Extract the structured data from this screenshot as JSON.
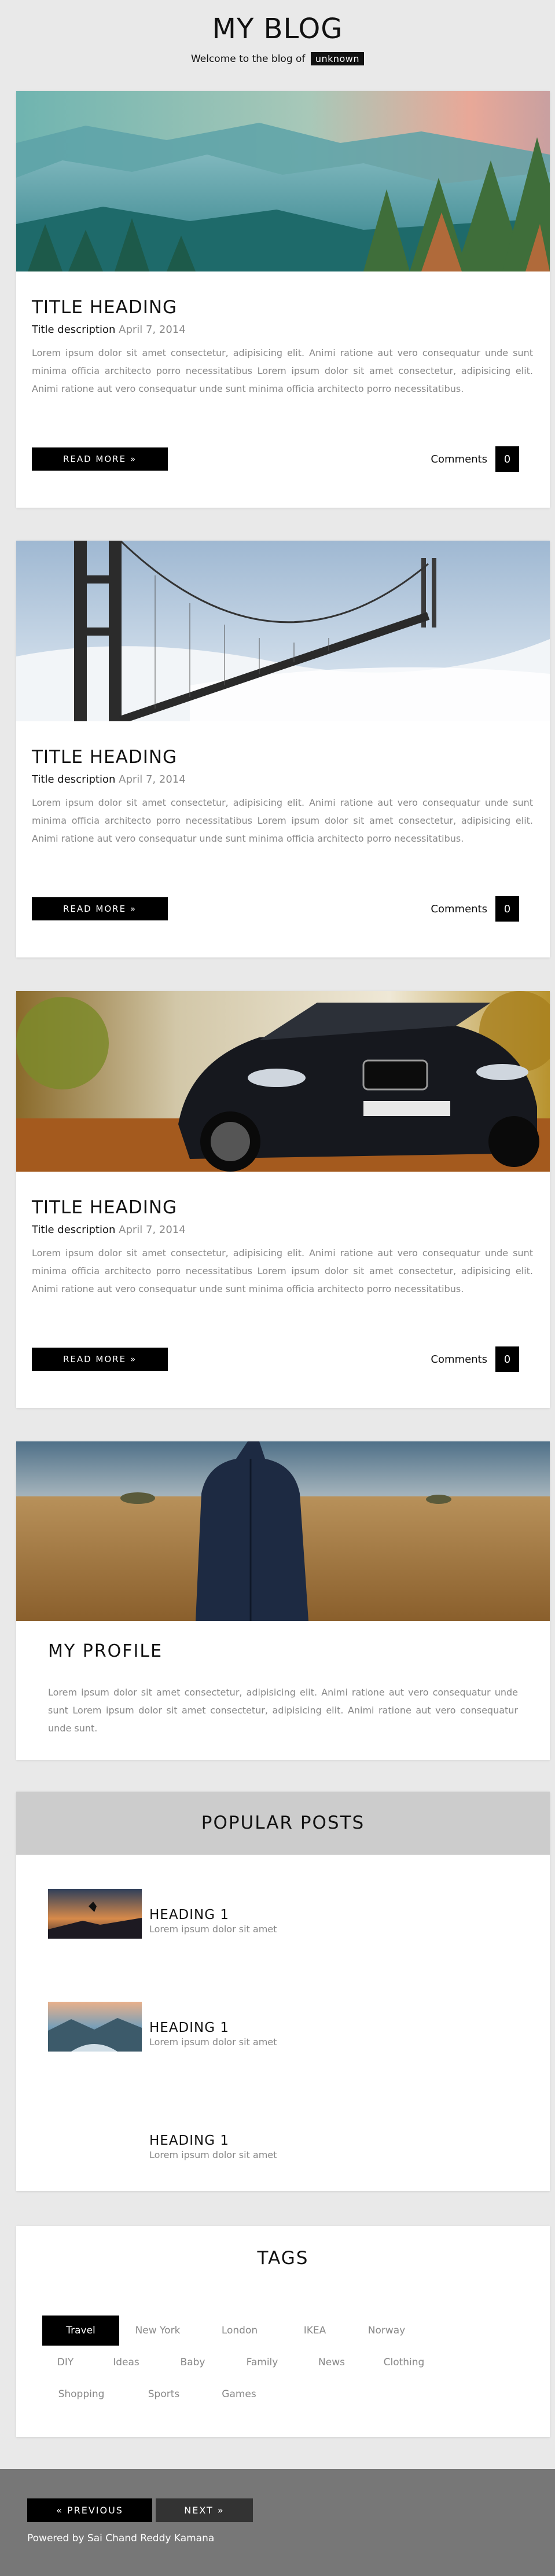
{
  "header": {
    "title": "MY BLOG",
    "subtitle": "Welcome to the blog of",
    "username": "unknown"
  },
  "posts": [
    {
      "image_icon": "forest-landscape-image",
      "heading": "TITLE HEADING",
      "description": "Title description",
      "date": "April 7, 2014",
      "body": "Lorem ipsum dolor sit amet consectetur, adipisicing elit. Animi ratione aut vero consequatur unde sunt minima officia architecto porro necessitatibus Lorem ipsum dolor sit amet consectetur, adipisicing elit. Animi ratione aut vero consequatur unde sunt minima officia architecto porro necessitatibus.",
      "read_more": "READ MORE »",
      "comments_label": "Comments",
      "comments_count": "0"
    },
    {
      "image_icon": "golden-gate-bridge-image",
      "heading": "TITLE HEADING",
      "description": "Title description",
      "date": "April 7, 2014",
      "body": "Lorem ipsum dolor sit amet consectetur, adipisicing elit. Animi ratione aut vero consequatur unde sunt minima officia architecto porro necessitatibus Lorem ipsum dolor sit amet consectetur, adipisicing elit. Animi ratione aut vero consequatur unde sunt minima officia architecto porro necessitatibus.",
      "read_more": "READ MORE »",
      "comments_label": "Comments",
      "comments_count": "0"
    },
    {
      "image_icon": "black-car-image",
      "heading": "TITLE HEADING",
      "description": "Title description",
      "date": "April 7, 2014",
      "body": "Lorem ipsum dolor sit amet consectetur, adipisicing elit. Animi ratione aut vero consequatur unde sunt minima officia architecto porro necessitatibus Lorem ipsum dolor sit amet consectetur, adipisicing elit. Animi ratione aut vero consequatur unde sunt minima officia architecto porro necessitatibus.",
      "read_more": "READ MORE »",
      "comments_label": "Comments",
      "comments_count": "0"
    }
  ],
  "profile": {
    "image_icon": "person-in-field-image",
    "heading": "MY PROFILE",
    "body": "Lorem ipsum dolor sit amet consectetur, adipisicing elit. Animi ratione aut vero consequatur unde sunt Lorem ipsum dolor sit amet consectetur, adipisicing elit. Animi ratione aut vero consequatur unde sunt."
  },
  "popular": {
    "title": "POPULAR POSTS",
    "items": [
      {
        "heading": "HEADING 1",
        "desc": "Lorem ipsum dolor sit amet",
        "thumb_icon": "sunset-jump-thumbnail"
      },
      {
        "heading": "HEADING 1",
        "desc": "Lorem ipsum dolor sit amet",
        "thumb_icon": "mountain-lake-thumbnail"
      },
      {
        "heading": "HEADING 1",
        "desc": "Lorem ipsum dolor sit amet",
        "thumb_icon": ""
      }
    ]
  },
  "tags": {
    "title": "TAGS",
    "items": [
      "Travel",
      "New York",
      "London",
      "IKEA",
      "Norway",
      "DIY",
      "Ideas",
      "Baby",
      "Family",
      "News",
      "Clothing",
      "Shopping",
      "Sports",
      "Games"
    ],
    "active": "Travel"
  },
  "footer": {
    "previous": "« PREVIOUS",
    "next": "NEXT »",
    "credit": "Powered by Sai Chand Reddy Kamana"
  },
  "colors": {
    "page_bg": "#e9e9e9",
    "card_bg": "#ffffff",
    "accent": "#000000",
    "footer_bg": "#777777",
    "muted_text": "#888888"
  }
}
